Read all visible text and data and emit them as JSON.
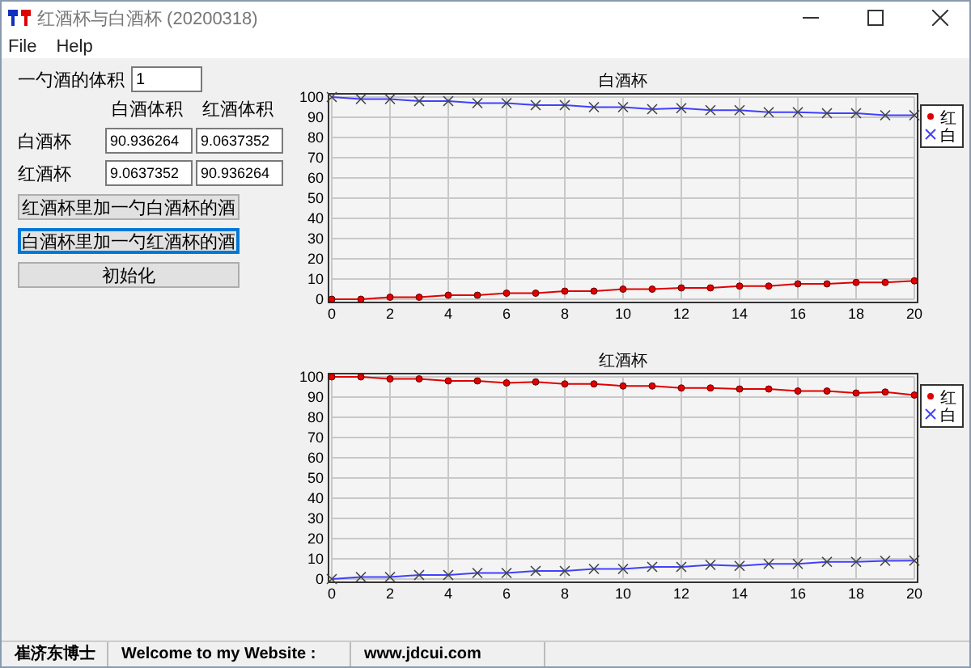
{
  "window": {
    "title": "红酒杯与白酒杯 (20200318)"
  },
  "menu": [
    "File",
    "Help"
  ],
  "spoon": {
    "label": "一勺酒的体积",
    "value": "1"
  },
  "volumes": {
    "columns": [
      "白酒体积",
      "红酒体积"
    ],
    "rows": [
      {
        "label": "白酒杯",
        "values": [
          "90.936264",
          "9.0637352"
        ]
      },
      {
        "label": "红酒杯",
        "values": [
          "9.0637352",
          "90.936264"
        ]
      }
    ]
  },
  "buttons": [
    {
      "label": "红酒杯里加一勺白酒杯的酒",
      "focused": false
    },
    {
      "label": "白酒杯里加一勺红酒杯的酒",
      "focused": true
    },
    {
      "label": "初始化",
      "focused": false
    }
  ],
  "charts": [
    {
      "chart_data": {
        "type": "line",
        "title": "白酒杯",
        "x": [
          0,
          1,
          2,
          3,
          4,
          5,
          6,
          7,
          8,
          9,
          10,
          11,
          12,
          13,
          14,
          15,
          16,
          17,
          18,
          19,
          20
        ],
        "xlim": [
          0,
          20
        ],
        "ylim": [
          0,
          100
        ],
        "xticks": [
          0,
          2,
          4,
          6,
          8,
          10,
          12,
          14,
          16,
          18,
          20
        ],
        "yticks": [
          0,
          10,
          20,
          30,
          40,
          50,
          60,
          70,
          80,
          90,
          100
        ],
        "grid": true,
        "legend": true,
        "series": [
          {
            "name": "红",
            "color": "#e00000",
            "marker": "circle",
            "values": [
              0,
              0,
              1,
              1,
              2,
              2,
              3,
              3,
              4,
              4,
              5,
              5,
              5.6,
              5.6,
              6.5,
              6.5,
              7.6,
              7.6,
              8.3,
              8.3,
              9.1
            ]
          },
          {
            "name": "白",
            "color": "#4040ff",
            "marker": "x",
            "values": [
              100,
              99,
              99,
              98,
              98,
              97,
              97,
              96,
              96,
              95,
              95,
              94,
              94.5,
              93.5,
              93.5,
              92.5,
              92.5,
              92,
              92,
              91,
              91
            ]
          }
        ]
      }
    },
    {
      "chart_data": {
        "type": "line",
        "title": "红酒杯",
        "x": [
          0,
          1,
          2,
          3,
          4,
          5,
          6,
          7,
          8,
          9,
          10,
          11,
          12,
          13,
          14,
          15,
          16,
          17,
          18,
          19,
          20
        ],
        "xlim": [
          0,
          20
        ],
        "ylim": [
          0,
          100
        ],
        "xticks": [
          0,
          2,
          4,
          6,
          8,
          10,
          12,
          14,
          16,
          18,
          20
        ],
        "yticks": [
          0,
          10,
          20,
          30,
          40,
          50,
          60,
          70,
          80,
          90,
          100
        ],
        "grid": true,
        "legend": true,
        "series": [
          {
            "name": "红",
            "color": "#e00000",
            "marker": "circle",
            "values": [
              100,
              100,
              99,
              99,
              98,
              98,
              97,
              97.5,
              96.5,
              96.5,
              95.5,
              95.5,
              94.5,
              94.5,
              94,
              94,
              93,
              93,
              92,
              92.5,
              91
            ]
          },
          {
            "name": "白",
            "color": "#4040ff",
            "marker": "x",
            "values": [
              0,
              1,
              1,
              2,
              2,
              3,
              3,
              4,
              4,
              5,
              5,
              6,
              6,
              7,
              6.5,
              7.5,
              7.5,
              8.5,
              8.5,
              9,
              9.1
            ]
          }
        ]
      }
    }
  ],
  "status_bar": [
    "崔济东博士",
    "Welcome to my Website :",
    "www.jdcui.com"
  ]
}
